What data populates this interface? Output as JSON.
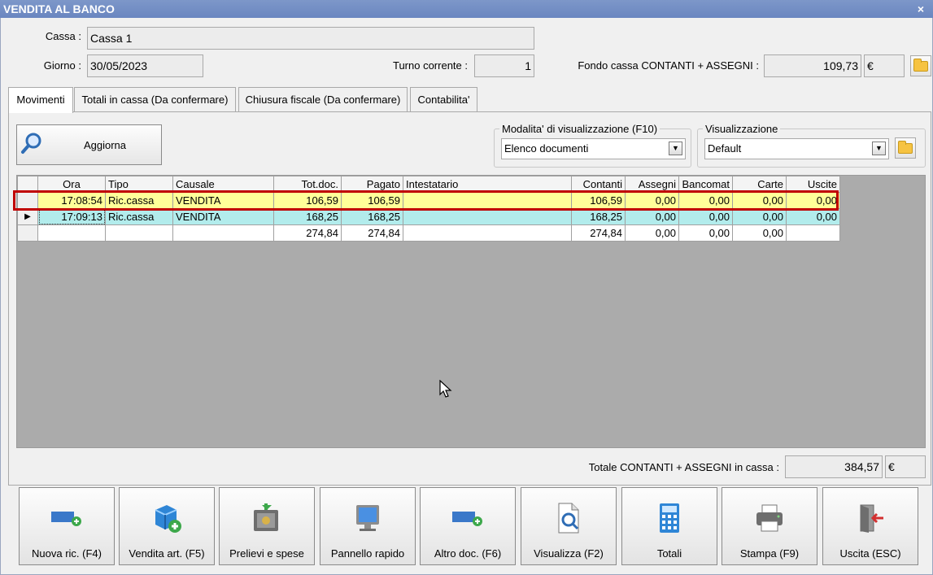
{
  "window": {
    "title": "VENDITA AL BANCO",
    "close_glyph": "×"
  },
  "header": {
    "cassa_label": "Cassa :",
    "cassa_value": "Cassa 1",
    "giorno_label": "Giorno :",
    "giorno_value": "30/05/2023",
    "turno_label": "Turno corrente :",
    "turno_value": "1",
    "fondo_label": "Fondo cassa CONTANTI + ASSEGNI :",
    "fondo_value": "109,73",
    "fondo_currency": "€"
  },
  "tabs": [
    {
      "label": "Movimenti",
      "active": true
    },
    {
      "label": "Totali in cassa (Da confermare)"
    },
    {
      "label": "Chiusura fiscale (Da confermare)"
    },
    {
      "label": "Contabilita'"
    }
  ],
  "toolbar": {
    "refresh_label": "Aggiorna"
  },
  "modalita": {
    "title": "Modalita' di visualizzazione (F10)",
    "selected": "Elenco documenti"
  },
  "visualizzazione": {
    "title": "Visualizzazione",
    "selected": "Default"
  },
  "grid": {
    "columns": [
      "Ora",
      "Tipo",
      "Causale",
      "Tot.doc.",
      "Pagato",
      "Intestatario",
      "Contanti",
      "Assegni",
      "Bancomat",
      "Carte",
      "Uscite"
    ],
    "rows": [
      {
        "ora": "17:08:54",
        "tipo": "Ric.cassa",
        "causale": "VENDITA",
        "totdoc": "106,59",
        "pagato": "106,59",
        "intestatario": "",
        "contanti": "106,59",
        "assegni": "0,00",
        "bancomat": "0,00",
        "carte": "0,00",
        "uscite": "0,00"
      },
      {
        "ora": "17:09:13",
        "tipo": "Ric.cassa",
        "causale": "VENDITA",
        "totdoc": "168,25",
        "pagato": "168,25",
        "intestatario": "",
        "contanti": "168,25",
        "assegni": "0,00",
        "bancomat": "0,00",
        "carte": "0,00",
        "uscite": "0,00",
        "current_indicator": "▶"
      },
      {
        "ora": "",
        "tipo": "",
        "causale": "",
        "totdoc": "274,84",
        "pagato": "274,84",
        "intestatario": "",
        "contanti": "274,84",
        "assegni": "0,00",
        "bancomat": "0,00",
        "carte": "0,00",
        "uscite": ""
      }
    ]
  },
  "totale": {
    "label": "Totale CONTANTI + ASSEGNI in cassa :",
    "value": "384,57",
    "currency": "€"
  },
  "buttons": [
    {
      "label": "Nuova ric. (F4)",
      "icon": "new-receipt-icon"
    },
    {
      "label": "Vendita art. (F5)",
      "icon": "add-article-box-icon"
    },
    {
      "label": "Prelievi e spese",
      "icon": "safe-icon"
    },
    {
      "label": "Pannello rapido",
      "icon": "monitor-icon"
    },
    {
      "label": "Altro doc. (F6)",
      "icon": "new-document-icon"
    },
    {
      "label": "Visualizza (F2)",
      "icon": "view-document-icon"
    },
    {
      "label": "Totali",
      "icon": "calculator-icon"
    },
    {
      "label": "Stampa (F9)",
      "icon": "printer-icon"
    },
    {
      "label": "Uscita (ESC)",
      "icon": "exit-door-icon"
    }
  ],
  "colors": {
    "title_bar": "#6a86c0",
    "selected_row": "#ffff99",
    "current_row": "#b2ecec",
    "highlight_outline": "#c00000",
    "grid_bg": "#ababab"
  }
}
